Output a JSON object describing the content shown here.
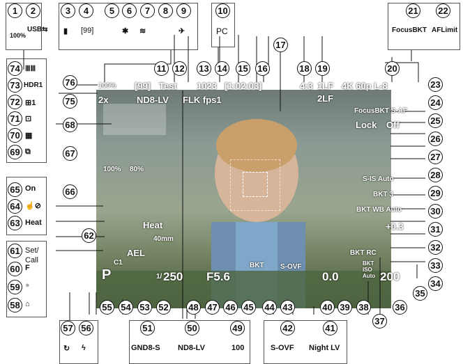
{
  "top_labels": {
    "l3": "[99]",
    "l4": "PC",
    "focus_bkt": "FocusBKT",
    "af_limit": "AFLimit"
  },
  "overlay": {
    "battery": "100%",
    "card": "[99]",
    "test": "Test",
    "card2": "1023",
    "time": "[1:02:03]",
    "aspect": "4:3",
    "quality1": "1LF",
    "quality2": "2LF",
    "video": "4K 60p L-8",
    "zoom": "2x",
    "iso_row": "ND8-LV",
    "flk": "FLK fps1",
    "focus_bkt": "FocusBKT S-AF",
    "lock": "Lock",
    "stab": "Off",
    "sis": "S-IS Auto",
    "bkt3": "BKT 3",
    "wb": "BKT WB Auto",
    "flash_comp": "+0.3",
    "bat_pct": "100%",
    "ext_pct": "80%",
    "heat": "Heat",
    "focal": "40mm",
    "ael": "AEL",
    "c1": "C1",
    "shutter": "250",
    "shutter_pre": "1/",
    "aperture": "F5.6",
    "bkt_scale": "BKT",
    "sovf": "S-OVF",
    "exp": "0.0",
    "bkt_rc": "BKT RC",
    "iso": "200",
    "iso_label": "BKT ISO Auto",
    "mode": "P"
  },
  "left_icons": {
    "on": "On",
    "heat": "Heat",
    "hdr": "HDR1",
    "set_call": "Set/ Call",
    "f": "F"
  },
  "bottom_labels": {
    "gnd": "GND8-S",
    "nd": "ND8-LV",
    "burst": "100",
    "sovf": "S-OVF",
    "night": "Night LV"
  },
  "markers": [
    "1",
    "2",
    "3",
    "4",
    "5",
    "6",
    "7",
    "8",
    "9",
    "10",
    "11",
    "12",
    "13",
    "14",
    "15",
    "16",
    "17",
    "18",
    "19",
    "20",
    "21",
    "22",
    "23",
    "24",
    "25",
    "26",
    "27",
    "28",
    "29",
    "30",
    "31",
    "32",
    "33",
    "34",
    "35",
    "36",
    "37",
    "38",
    "39",
    "40",
    "41",
    "42",
    "43",
    "44",
    "45",
    "46",
    "47",
    "48",
    "49",
    "50",
    "51",
    "52",
    "53",
    "54",
    "55",
    "56",
    "57",
    "58",
    "59",
    "60",
    "61",
    "62",
    "63",
    "64",
    "65",
    "66",
    "67",
    "68",
    "69",
    "70",
    "71",
    "72",
    "73",
    "74",
    "75",
    "76"
  ]
}
